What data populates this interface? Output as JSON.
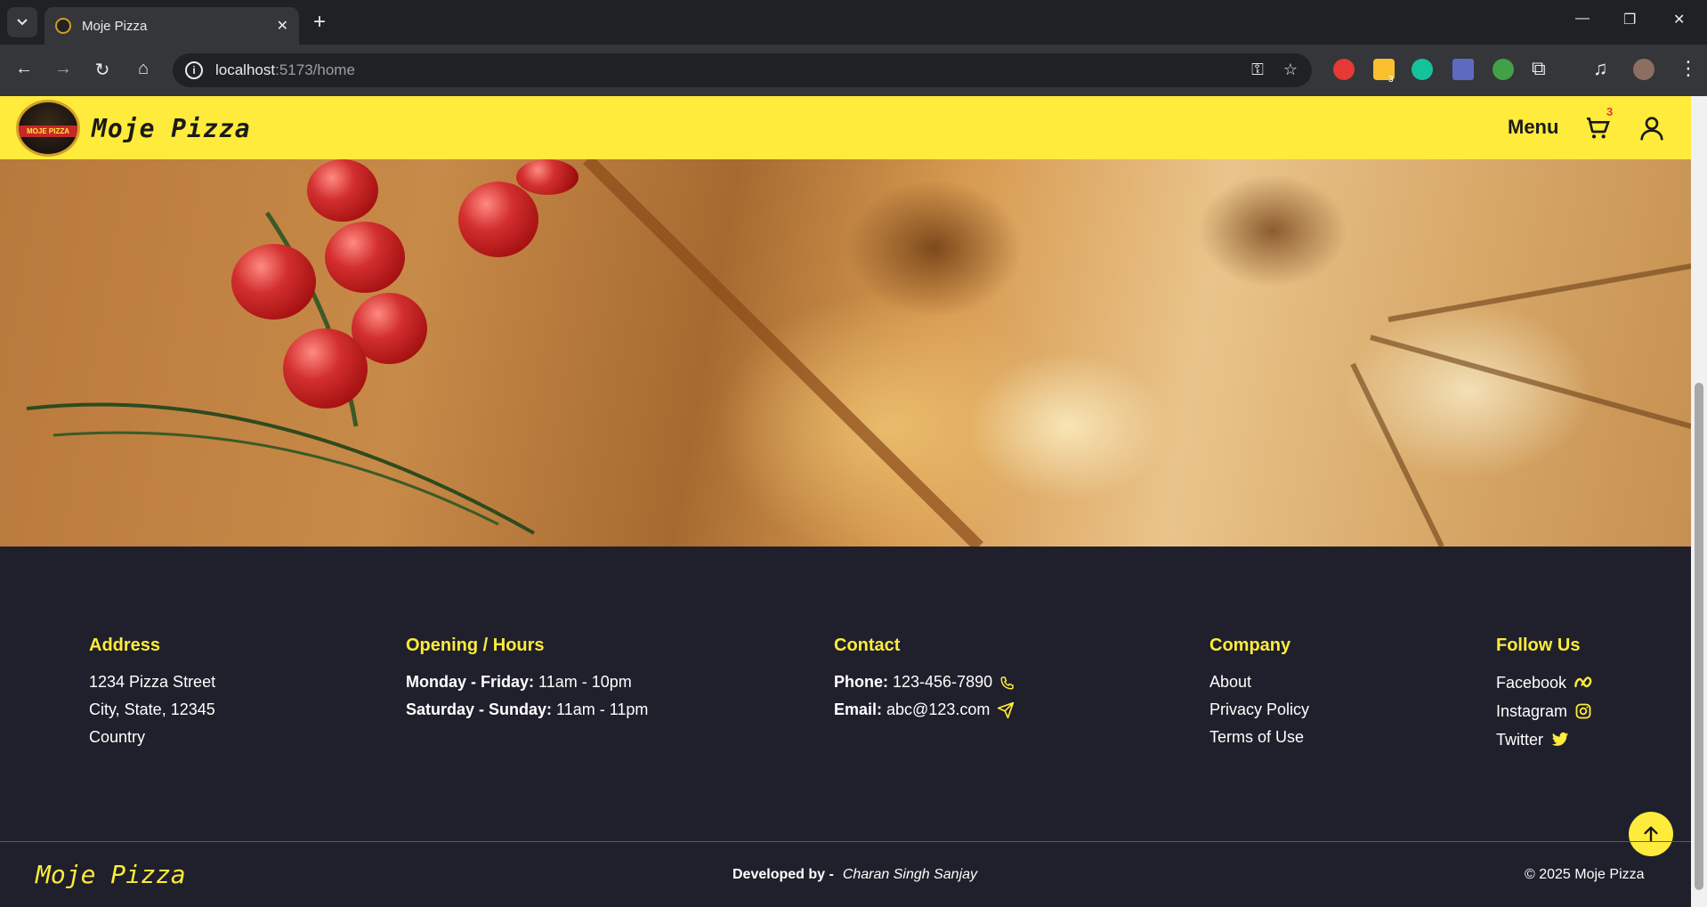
{
  "browser": {
    "tab_title": "Moje Pizza",
    "url_host": "localhost",
    "url_path": ":5173/home",
    "extension_badge": "3"
  },
  "header": {
    "brand": "Moje Pizza",
    "logo_text": "MOJE PIZZA",
    "menu_label": "Menu",
    "cart_count": "3"
  },
  "footer": {
    "address": {
      "heading": "Address",
      "lines": [
        "1234 Pizza Street",
        "City, State, 12345",
        "Country"
      ]
    },
    "hours": {
      "heading": "Opening / Hours",
      "rows": [
        {
          "label": "Monday - Friday:",
          "value": "11am - 10pm"
        },
        {
          "label": "Saturday - Sunday:",
          "value": "11am - 11pm"
        }
      ]
    },
    "contact": {
      "heading": "Contact",
      "phone_label": "Phone:",
      "phone": "123-456-7890",
      "email_label": "Email:",
      "email": "abc@123.com"
    },
    "company": {
      "heading": "Company",
      "links": [
        "About",
        "Privacy Policy",
        "Terms of Use"
      ]
    },
    "follow": {
      "heading": "Follow Us",
      "links": [
        "Facebook",
        "Instagram",
        "Twitter"
      ]
    },
    "brand": "Moje Pizza",
    "developed_by_label": "Developed by -",
    "developer": "Charan Singh Sanjay",
    "copyright": "© 2025 Moje Pizza"
  },
  "colors": {
    "header_bg": "#ffeb3b",
    "footer_bg": "#1f202b",
    "accent": "#ffeb3b"
  }
}
